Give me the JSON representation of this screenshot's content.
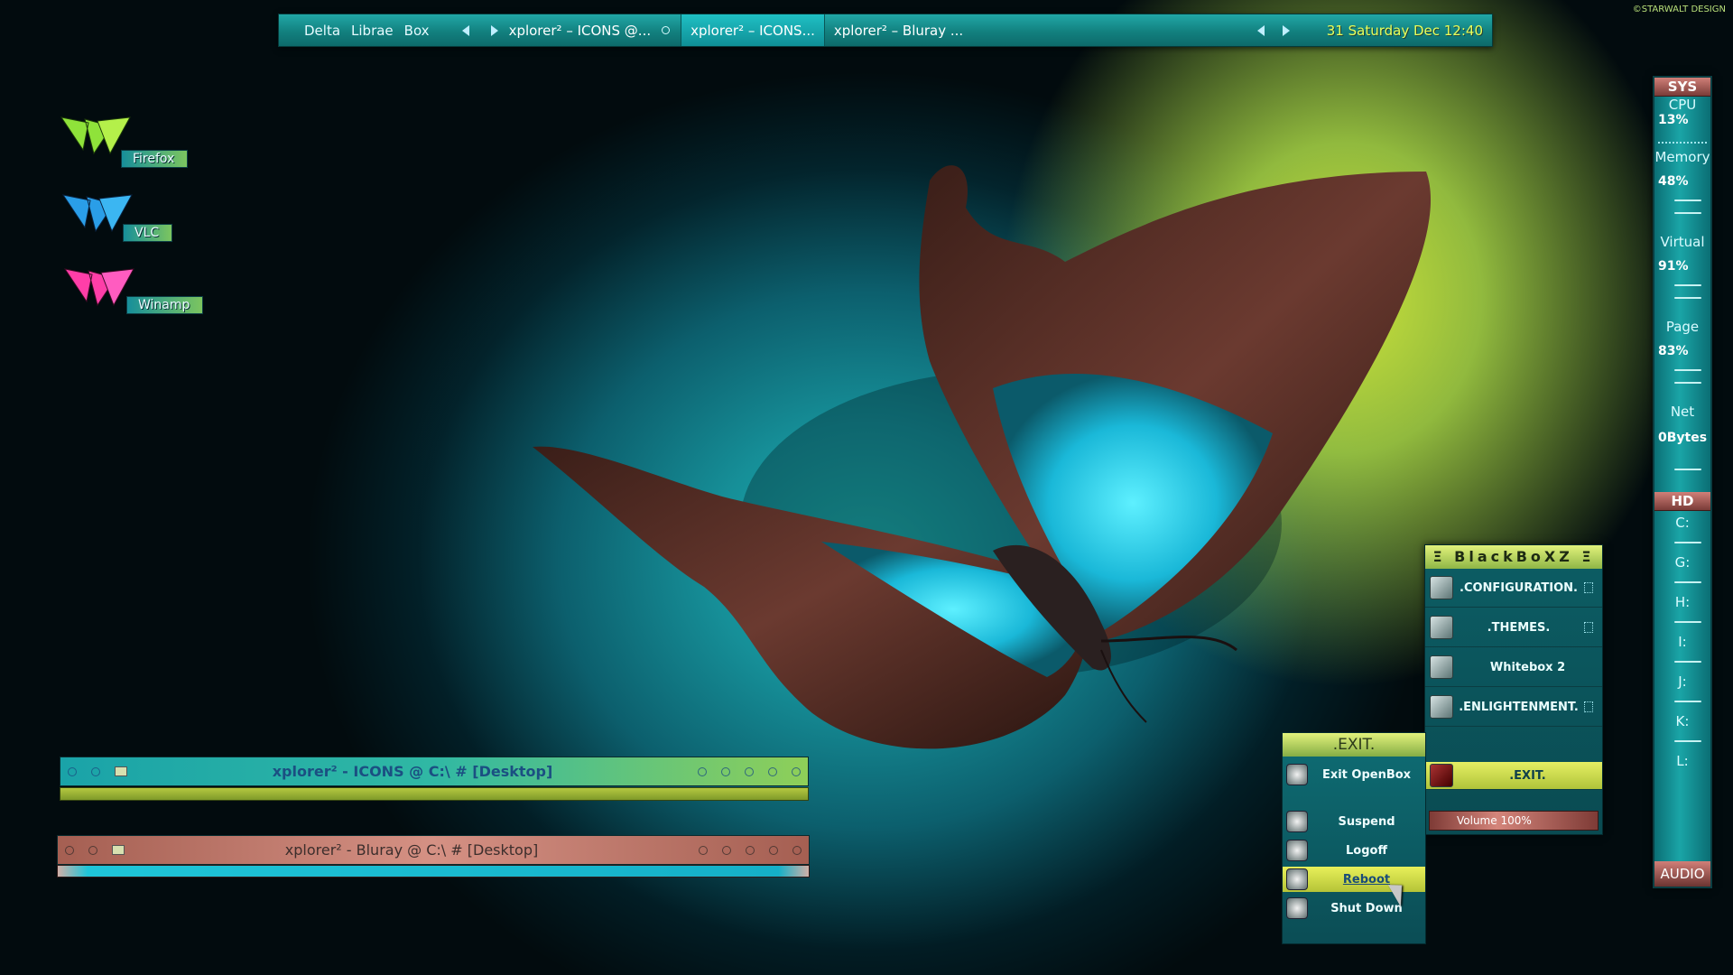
{
  "credit": "©STARWALT DESIGN",
  "topbar": {
    "workspaces": [
      "Delta",
      "Librae",
      "Box"
    ],
    "tasks": [
      {
        "label": "xplorer² – ICONS @..."
      },
      {
        "label": "xplorer² – ICONS..."
      },
      {
        "label": "xplorer² – Bluray ..."
      }
    ],
    "clock": "31 Saturday Dec 12:40"
  },
  "desktop_icons": [
    {
      "label": "Firefox",
      "color": "#8fe23a"
    },
    {
      "label": "VLC",
      "color": "#2a9ee8"
    },
    {
      "label": "Winamp",
      "color": "#ff3ea8"
    }
  ],
  "sys_panel": {
    "header": "SYS",
    "stats": [
      {
        "label": "CPU",
        "value": "13%"
      },
      {
        "label": "Memory",
        "value": "48%"
      },
      {
        "label": "Virtual",
        "value": "91%"
      },
      {
        "label": "Page",
        "value": "83%"
      },
      {
        "label": "Net",
        "value": "0Bytes"
      }
    ],
    "hd_header": "HD",
    "drives": [
      "C:",
      "G:",
      "H:",
      "I:",
      "J:",
      "K:",
      "L:"
    ],
    "footer": "AUDIO"
  },
  "blackbox_menu": {
    "title": "Ξ BlackBoXZ Ξ",
    "items": [
      {
        "label": ".CONFIGURATION."
      },
      {
        "label": ".THEMES."
      },
      {
        "label": "Whitebox 2"
      },
      {
        "label": ".ENLIGHTENMENT."
      },
      {
        "label": ".EXIT."
      }
    ],
    "volume": "Volume 100%"
  },
  "exit_menu": {
    "title": ".EXIT.",
    "items": [
      {
        "label": "Exit OpenBox"
      },
      {
        "label": "Suspend"
      },
      {
        "label": "Logoff"
      },
      {
        "label": "Reboot"
      },
      {
        "label": "Shut Down"
      }
    ]
  },
  "windows": [
    {
      "title": "xplorer² - ICONS @ C:\\ # [Desktop]"
    },
    {
      "title": "xplorer² - Bluray @ C:\\ # [Desktop]"
    }
  ]
}
